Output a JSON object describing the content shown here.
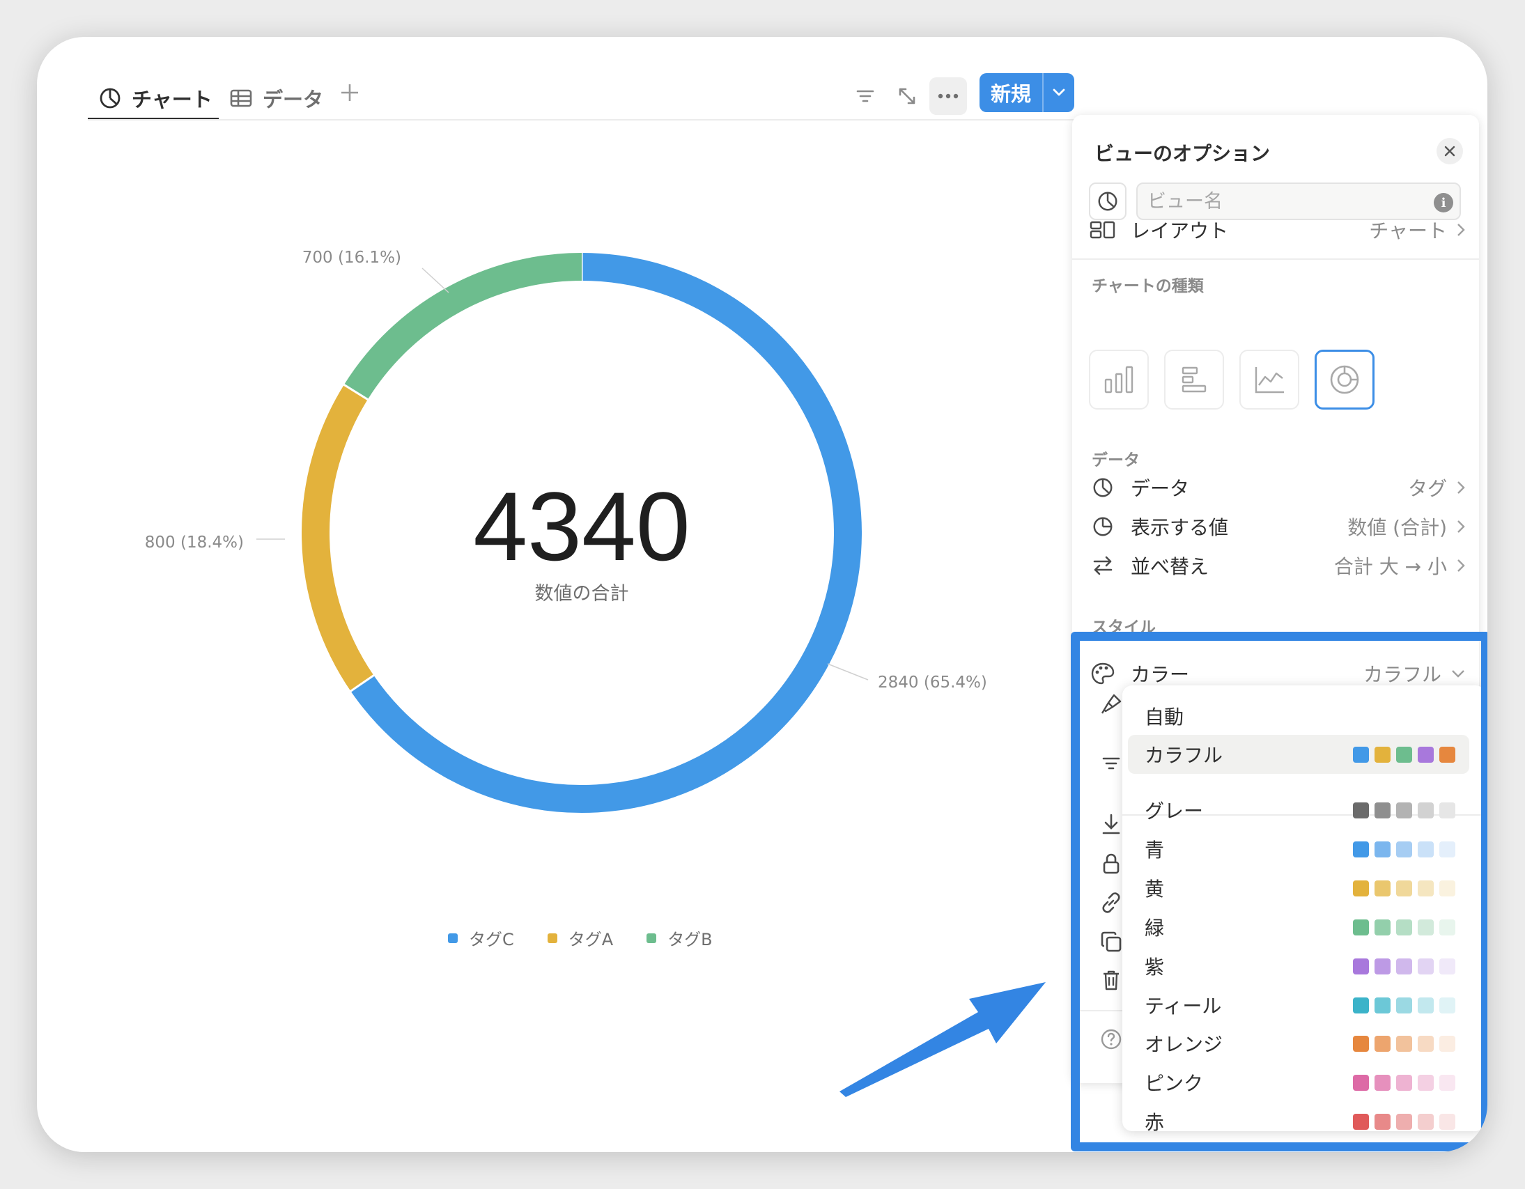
{
  "tabs": [
    {
      "label": "チャート",
      "active": true,
      "icon": "pie-chart-icon"
    },
    {
      "label": "データ",
      "active": false,
      "icon": "table-icon"
    }
  ],
  "toolbar": {
    "new_label": "新規"
  },
  "chart_data": {
    "type": "pie",
    "variant": "donut",
    "center_value": "4340",
    "center_label": "数値の合計",
    "slices": [
      {
        "name": "タグC",
        "value": 2840,
        "label": "2840 (65.4%)",
        "color": "#4299e7"
      },
      {
        "name": "タグA",
        "value": 800,
        "label": "800 (18.4%)",
        "color": "#e3b23c"
      },
      {
        "name": "タグB",
        "value": 700,
        "label": "700 (16.1%)",
        "color": "#6dbd8e"
      }
    ],
    "legend_position": "bottom"
  },
  "panel": {
    "title": "ビューのオプション",
    "view_name_placeholder": "ビュー名",
    "layout": {
      "label": "レイアウト",
      "value": "チャート"
    },
    "chart_type_section": "チャートの種類",
    "chart_types": [
      "bar-chart-icon",
      "horizontal-bar-chart-icon",
      "line-chart-icon",
      "donut-chart-icon"
    ],
    "selected_chart_type": "donut-chart-icon",
    "data_section": "データ",
    "data_rows": [
      {
        "label": "データ",
        "value": "タグ",
        "icon": "pie-chart-icon"
      },
      {
        "label": "表示する値",
        "value": "数値 (合計)",
        "icon": "pie-slice-icon"
      },
      {
        "label": "並べ替え",
        "value": "合計 大 → 小",
        "icon": "swap-icon"
      }
    ],
    "style_section": "スタイル",
    "color_row": {
      "label": "カラー",
      "value": "カラフル"
    }
  },
  "color_dropdown": {
    "items": [
      {
        "label": "自動",
        "swatches": []
      },
      {
        "label": "カラフル",
        "selected": true,
        "swatches": [
          "#4299e7",
          "#e3b23c",
          "#6dbd8e",
          "#a878dc",
          "#e6873e"
        ]
      },
      {
        "label": "グレー",
        "swatches": [
          "#6b6b6b",
          "#8f8f8f",
          "#b3b3b3",
          "#d2d2d2",
          "#e6e6e6"
        ]
      },
      {
        "label": "青",
        "swatches": [
          "#4299e7",
          "#7bb6ee",
          "#a6cdf3",
          "#cae1f8",
          "#e4effb"
        ]
      },
      {
        "label": "黄",
        "swatches": [
          "#e3b23c",
          "#eac76e",
          "#f0d89a",
          "#f5e6c0",
          "#faf2df"
        ]
      },
      {
        "label": "緑",
        "swatches": [
          "#6dbd8e",
          "#93cfab",
          "#b5dec5",
          "#d2eadb",
          "#e8f5ed"
        ]
      },
      {
        "label": "紫",
        "swatches": [
          "#a878dc",
          "#bd9ae5",
          "#d0b8ec",
          "#e2d4f3",
          "#f0e9f9"
        ]
      },
      {
        "label": "ティール",
        "swatches": [
          "#3bb3c9",
          "#6cc8d7",
          "#9bd9e3",
          "#c2e8ee",
          "#e0f3f6"
        ]
      },
      {
        "label": "オレンジ",
        "swatches": [
          "#e6873e",
          "#eda56e",
          "#f2c29c",
          "#f7dac3",
          "#fbede2"
        ]
      },
      {
        "label": "ピンク",
        "swatches": [
          "#dd6aa6",
          "#e690bd",
          "#eeb3d2",
          "#f4d0e3",
          "#f9e7f1"
        ]
      },
      {
        "label": "赤",
        "swatches": [
          "#e05a5a",
          "#e88989",
          "#eeaeae",
          "#f4cece",
          "#f9e6e6"
        ]
      }
    ]
  },
  "colors": {
    "accent": "#3c8ee6",
    "highlight": "#3385e3"
  }
}
